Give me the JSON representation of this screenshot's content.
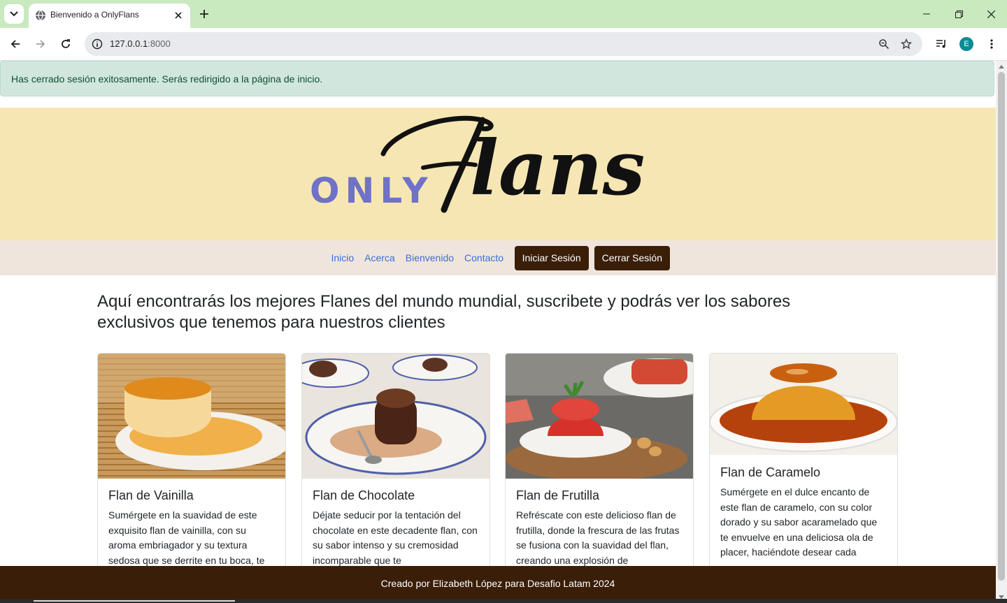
{
  "browser": {
    "tab_title": "Bienvenido a OnlyFlans",
    "url_host": "127.0.0.1",
    "url_port": ":8000",
    "profile_initial": "E",
    "icons": [
      "tab-search-icon",
      "globe-icon",
      "close-icon",
      "plus-icon",
      "minimize-icon",
      "restore-icon",
      "window-close-icon",
      "back-arrow-icon",
      "forward-arrow-icon",
      "reload-icon",
      "info-icon",
      "zoom-icon",
      "star-icon",
      "media-icon",
      "more-vert-icon"
    ]
  },
  "alert": {
    "message": "Has cerrado sesión exitosamente. Serás redirigido a la página de inicio.",
    "color": "#d1e7dd"
  },
  "logo": {
    "prefix": "ONLY",
    "script": "Flans",
    "prefix_color": "#6f72c7",
    "banner_color": "#f6e6b4"
  },
  "nav": {
    "links": [
      "Inicio",
      "Acerca",
      "Bienvenido",
      "Contacto"
    ],
    "login": "Iniciar Sesión",
    "logout": "Cerrar Sesión",
    "button_color": "#3a1e08"
  },
  "lead": "Aquí encontrarás los mejores Flanes del mundo mundial, suscribete y podrás ver los sabores exclusivos que tenemos para nuestros clientes",
  "cards": [
    {
      "title": "Flan de Vainilla",
      "text": "Sumérgete en la suavidad de este exquisito flan de vainilla, con su aroma embriagador y su textura sedosa que se derrite en tu boca, te",
      "image": "flan-vainilla-photo"
    },
    {
      "title": "Flan de Chocolate",
      "text": "Déjate seducir por la tentación del chocolate en este decadente flan, con su sabor intenso y su cremosidad incomparable que te",
      "image": "flan-chocolate-photo"
    },
    {
      "title": "Flan de Frutilla",
      "text": "Refréscate con este delicioso flan de frutilla, donde la frescura de las frutas se fusiona con la suavidad del flan, creando una explosión de",
      "image": "flan-frutilla-photo"
    },
    {
      "title": "Flan de Caramelo",
      "text": "Sumérgete en el dulce encanto de este flan de caramelo, con su color dorado y su sabor acaramelado que te envuelve en una deliciosa ola de placer, haciéndote desear cada",
      "image": "flan-caramelo-photo"
    }
  ],
  "footer": {
    "text": "Creado por Elizabeth López para Desafio Latam 2024",
    "color": "#3a1e08"
  }
}
